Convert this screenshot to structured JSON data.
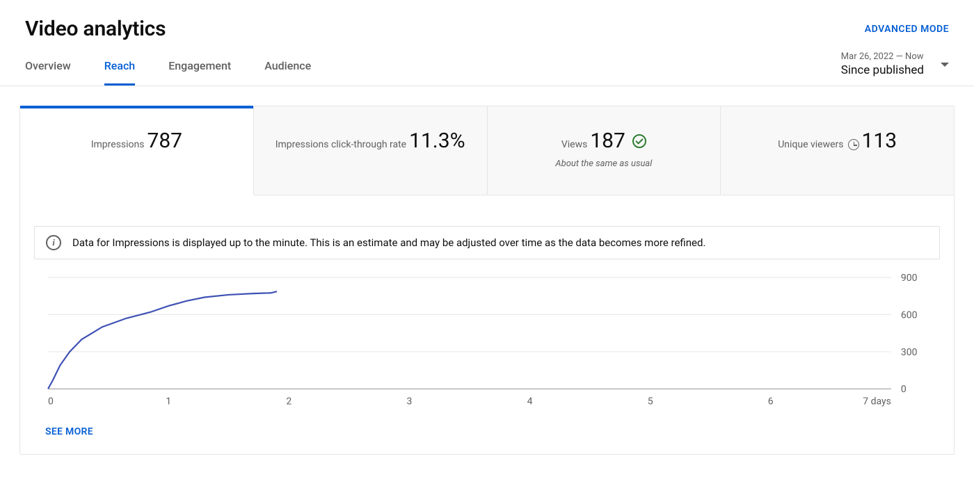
{
  "header": {
    "title": "Video analytics",
    "advanced_mode": "ADVANCED MODE"
  },
  "tabs": [
    {
      "id": "overview",
      "label": "Overview",
      "active": false
    },
    {
      "id": "reach",
      "label": "Reach",
      "active": true
    },
    {
      "id": "engagement",
      "label": "Engagement",
      "active": false
    },
    {
      "id": "audience",
      "label": "Audience",
      "active": false
    }
  ],
  "date_picker": {
    "range_text": "Mar 26, 2022 — Now",
    "label": "Since published"
  },
  "metrics": [
    {
      "id": "impressions",
      "label": "Impressions",
      "value": "787",
      "active": true
    },
    {
      "id": "ctr",
      "label": "Impressions click-through rate",
      "value": "11.3%",
      "active": false
    },
    {
      "id": "views",
      "label": "Views",
      "value": "187",
      "active": false,
      "status": "ok",
      "subtext": "About the same as usual"
    },
    {
      "id": "unique",
      "label": "Unique viewers",
      "value": "113",
      "active": false,
      "has_clock": true
    }
  ],
  "info_banner": "Data for Impressions is displayed up to the minute. This is an estimate and may be adjusted over time as the data becomes more refined.",
  "see_more": "SEE MORE",
  "chart_data": {
    "type": "line",
    "title": "",
    "xlabel": "days",
    "ylabel": "",
    "xlim": [
      0,
      7
    ],
    "ylim": [
      0,
      900
    ],
    "x_ticks": [
      0,
      1,
      2,
      3,
      4,
      5,
      6,
      7
    ],
    "x_tick_labels": [
      "0",
      "1",
      "2",
      "3",
      "4",
      "5",
      "6",
      "7 days"
    ],
    "y_ticks": [
      0,
      300,
      600,
      900
    ],
    "series": [
      {
        "name": "Impressions",
        "color": "#3f51b5",
        "x": [
          0.0,
          0.04,
          0.1,
          0.18,
          0.28,
          0.45,
          0.65,
          0.85,
          1.0,
          1.15,
          1.3,
          1.5,
          1.7,
          1.85,
          1.9
        ],
        "values": [
          0,
          70,
          190,
          300,
          400,
          500,
          570,
          620,
          670,
          710,
          740,
          760,
          770,
          775,
          787
        ]
      }
    ]
  }
}
